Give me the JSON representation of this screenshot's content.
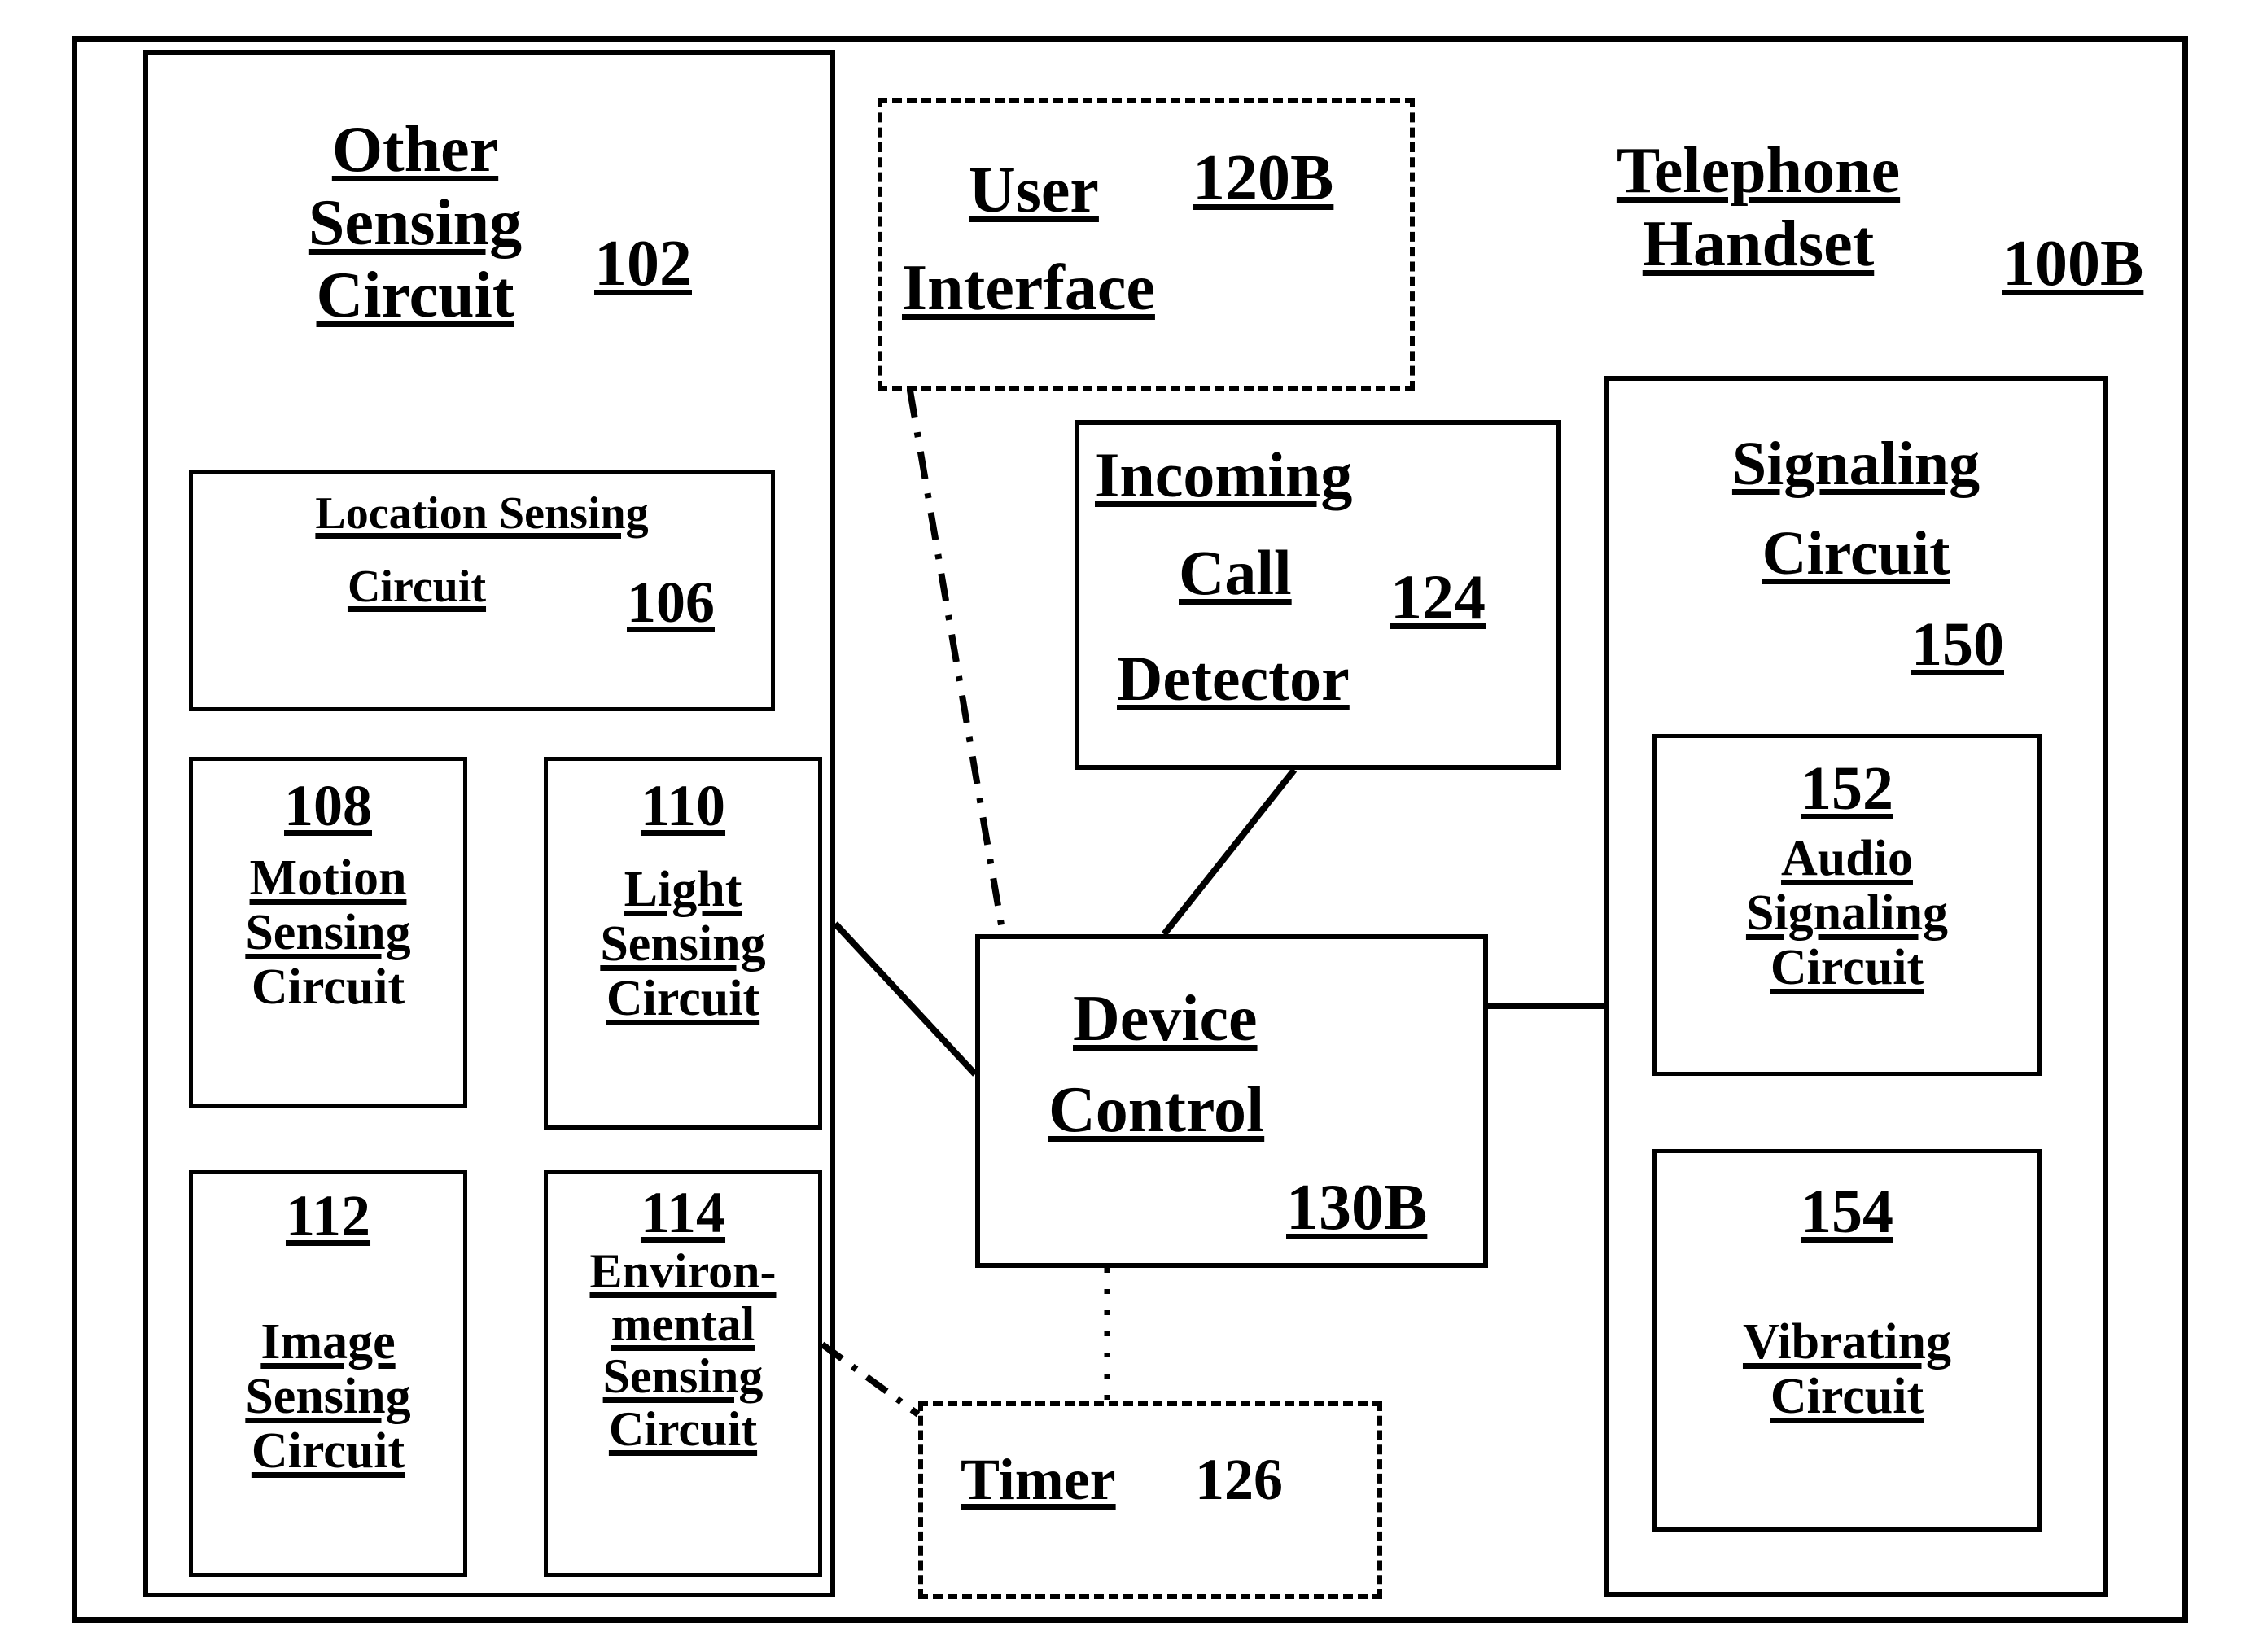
{
  "diagram": {
    "title": "Telephone Handset block diagram",
    "outer_frame": {
      "label": ""
    },
    "other_sensing_circuit": {
      "title_lines": [
        "Other",
        "Sensing",
        "Circuit"
      ],
      "ref": "102",
      "location_sensing": {
        "line1": "Location Sensing",
        "line2": "Circuit",
        "ref": "106"
      },
      "sub_blocks": [
        {
          "ref": "108",
          "lines": [
            "Motion",
            "Sensing",
            "Circuit"
          ],
          "underline_last": false
        },
        {
          "ref": "110",
          "lines": [
            "Light",
            "Sensing",
            "Circuit"
          ],
          "underline_last": true
        },
        {
          "ref": "112",
          "lines": [
            "Image",
            "Sensing",
            "Circuit"
          ],
          "underline_last": true
        },
        {
          "ref": "114",
          "lines": [
            "Environ-",
            "mental",
            "Sensing",
            "Circuit"
          ],
          "underline_last": true
        }
      ]
    },
    "user_interface": {
      "line1": "User",
      "line2": "Interface",
      "ref": "120B",
      "border_style": "dash-dot"
    },
    "incoming_call_detector": {
      "line1": "Incoming",
      "line2": "Call",
      "line3": "Detector",
      "ref": "124"
    },
    "device_control": {
      "line1": "Device",
      "line2": "Control",
      "ref": "130B"
    },
    "timer": {
      "label": "Timer",
      "ref": "126",
      "border_style": "dash-dot-dot"
    },
    "telephone_handset": {
      "title_lines": [
        "Telephone",
        "Handset"
      ],
      "ref": "100B",
      "signaling_circuit": {
        "title_lines": [
          "Signaling",
          "Circuit"
        ],
        "ref": "150",
        "sub_blocks": [
          {
            "ref": "152",
            "lines": [
              "Audio",
              "Signaling",
              "Circuit"
            ]
          },
          {
            "ref": "154",
            "lines": [
              "Vibrating",
              "Circuit"
            ]
          }
        ]
      }
    },
    "connections": [
      {
        "from": "other-sensing-circuit",
        "to": "device-control",
        "style": "solid"
      },
      {
        "from": "user-interface",
        "to": "device-control",
        "style": "dash-dot"
      },
      {
        "from": "incoming-call-detector",
        "to": "device-control",
        "style": "solid"
      },
      {
        "from": "device-control",
        "to": "signaling-circuit",
        "style": "solid"
      },
      {
        "from": "device-control",
        "to": "timer",
        "style": "dotted"
      },
      {
        "from": "environmental-sensing-circuit",
        "to": "timer",
        "style": "dash-dot"
      }
    ],
    "colors": {
      "ink": "#000000",
      "paper": "#ffffff"
    }
  }
}
